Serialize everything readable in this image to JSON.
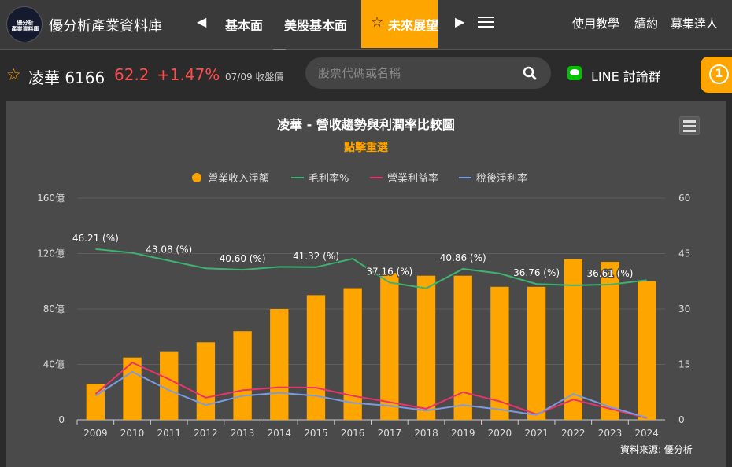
{
  "nav": {
    "brand": "優分析產業資料庫",
    "logo_text_1": "優分析",
    "logo_text_2": "產業資料庫",
    "items": [
      "基本面",
      "美股基本面"
    ],
    "active": "未來展望",
    "right": [
      "使用教學",
      "續約",
      "募集達人"
    ]
  },
  "stock": {
    "name": "凌華 6166",
    "price": "62.2",
    "change": "+1.47%",
    "date": "07/09 收盤價"
  },
  "search": {
    "placeholder": "股票代碼或名稱"
  },
  "line_label": "LINE 討論群",
  "badge": "1",
  "chart_title": "凌華 - 營收趨勢與利潤率比較圖",
  "reset_label": "點擊重選",
  "source": "資料來源: 優分析",
  "colors": {
    "bar": "#ffa500",
    "gross": "#3cb371",
    "operating": "#e8336c",
    "net": "#7b9be0"
  },
  "chart_data": {
    "type": "bar",
    "title": "凌華 - 營收趨勢與利潤率比較圖",
    "categories": [
      "2009",
      "2010",
      "2011",
      "2012",
      "2013",
      "2014",
      "2015",
      "2016",
      "2017",
      "2018",
      "2019",
      "2020",
      "2021",
      "2022",
      "2023",
      "2024"
    ],
    "left_axis": {
      "ticks": [
        "0",
        "40億",
        "80億",
        "120億",
        "160億"
      ],
      "ylim": [
        0,
        160
      ]
    },
    "right_axis": {
      "ticks": [
        "0",
        "15",
        "30",
        "45",
        "60"
      ],
      "ylim": [
        0,
        60
      ]
    },
    "legend_position": "top",
    "series": [
      {
        "name": "營業收入淨額",
        "kind": "bar",
        "axis": "left",
        "values": [
          26,
          45,
          49,
          56,
          64,
          80,
          90,
          95,
          106,
          104,
          104,
          96,
          96,
          116,
          114,
          100
        ]
      },
      {
        "name": "毛利率%",
        "kind": "line",
        "axis": "right",
        "values": [
          46.21,
          45.2,
          43.08,
          41.0,
          40.6,
          41.4,
          41.32,
          43.6,
          37.16,
          35.6,
          40.86,
          39.6,
          36.76,
          36.4,
          36.61,
          37.8
        ]
      },
      {
        "name": "營業利益率",
        "kind": "line",
        "axis": "right",
        "values": [
          7,
          15.5,
          11,
          6,
          8,
          8.8,
          8.7,
          6.5,
          4.8,
          3,
          7.5,
          5,
          1.5,
          5.5,
          3,
          0.5
        ]
      },
      {
        "name": "稅後淨利率",
        "kind": "line",
        "axis": "right",
        "values": [
          6.5,
          13,
          8,
          4,
          6.5,
          7.3,
          6.5,
          4.6,
          3.8,
          2.5,
          4,
          2.8,
          1.3,
          7,
          3.5,
          0.6
        ]
      }
    ],
    "annotations": [
      {
        "index": 0,
        "text": "46.21 (%)"
      },
      {
        "index": 2,
        "text": "43.08 (%)"
      },
      {
        "index": 4,
        "text": "40.60 (%)"
      },
      {
        "index": 6,
        "text": "41.32 (%)"
      },
      {
        "index": 8,
        "text": "37.16 (%)"
      },
      {
        "index": 10,
        "text": "40.86 (%)"
      },
      {
        "index": 12,
        "text": "36.76 (%)"
      },
      {
        "index": 14,
        "text": "36.61 (%)"
      }
    ]
  }
}
